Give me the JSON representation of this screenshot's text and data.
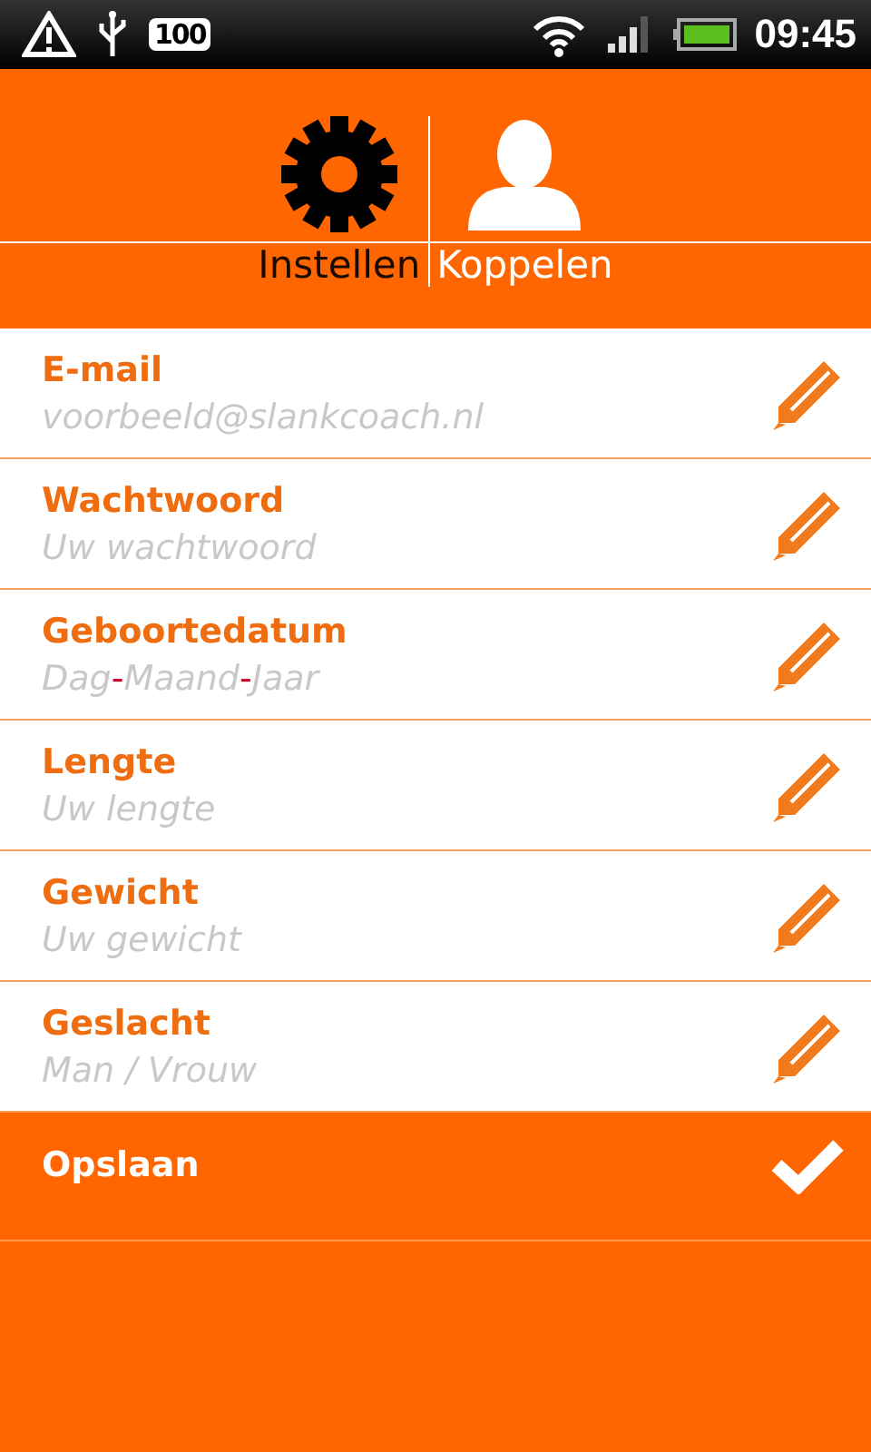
{
  "status_bar": {
    "battery_badge": "100",
    "time": "09:45"
  },
  "tabs": [
    {
      "label": "Instellen",
      "selected": true,
      "kind": "gear"
    },
    {
      "label": "Koppelen",
      "selected": false,
      "kind": "person"
    }
  ],
  "fields": [
    {
      "label": "E-mail",
      "placeholder": "voorbeeld@slankcoach.nl"
    },
    {
      "label": "Wachtwoord",
      "placeholder": "Uw wachtwoord"
    },
    {
      "label": "Geboortedatum",
      "placeholder_segments": [
        {
          "text": "Dag",
          "kind": "word"
        },
        {
          "text": "-",
          "kind": "separator"
        },
        {
          "text": "Maand",
          "kind": "word"
        },
        {
          "text": "-",
          "kind": "separator"
        },
        {
          "text": "Jaar",
          "kind": "word"
        }
      ]
    },
    {
      "label": "Lengte",
      "placeholder": "Uw lengte"
    },
    {
      "label": "Gewicht",
      "placeholder": "Uw gewicht"
    },
    {
      "label": "Geslacht",
      "placeholder": "Man / Vrouw"
    }
  ],
  "save_button": {
    "label": "Opslaan"
  }
}
